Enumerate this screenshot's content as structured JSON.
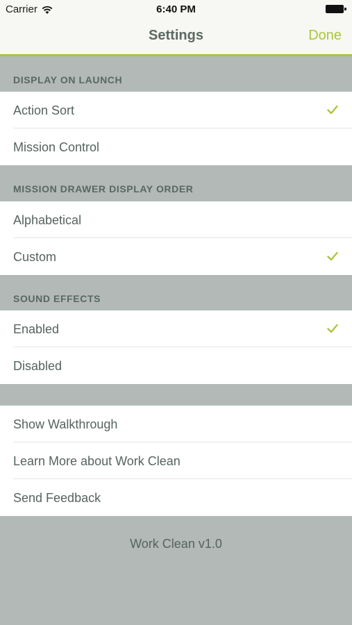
{
  "status_bar": {
    "carrier": "Carrier",
    "time": "6:40 PM"
  },
  "nav": {
    "title": "Settings",
    "done_label": "Done"
  },
  "sections": {
    "launch": {
      "header": "DISPLAY ON LAUNCH",
      "items": [
        {
          "label": "Action Sort",
          "checked": true
        },
        {
          "label": "Mission Control",
          "checked": false
        }
      ]
    },
    "drawer_order": {
      "header": "MISSION DRAWER DISPLAY ORDER",
      "items": [
        {
          "label": "Alphabetical",
          "checked": false
        },
        {
          "label": "Custom",
          "checked": true
        }
      ]
    },
    "sound": {
      "header": "SOUND EFFECTS",
      "items": [
        {
          "label": "Enabled",
          "checked": true
        },
        {
          "label": "Disabled",
          "checked": false
        }
      ]
    },
    "misc": {
      "items": [
        {
          "label": "Show Walkthrough"
        },
        {
          "label": "Learn More about Work Clean"
        },
        {
          "label": "Send Feedback"
        }
      ]
    }
  },
  "footer": {
    "version_text": "Work Clean v1.0"
  },
  "colors": {
    "accent": "#a9c63c",
    "background": "#b2b9b6",
    "text": "#56635f"
  }
}
